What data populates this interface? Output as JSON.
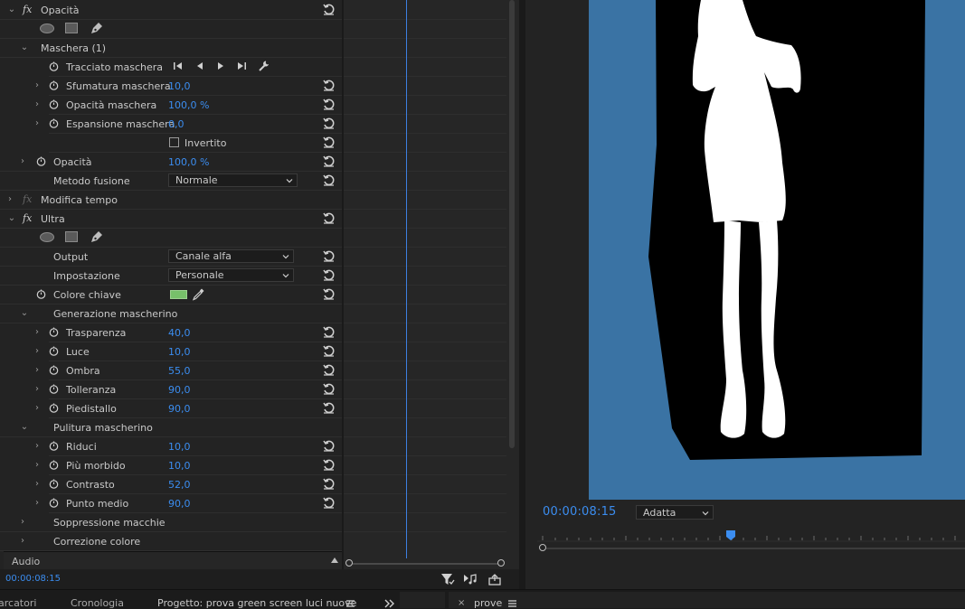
{
  "effect_controls": {
    "rows": {
      "opacity_effect": "Opacità",
      "mask1": "Maschera (1)",
      "mask_path": "Tracciato maschera",
      "mask_feather": {
        "label": "Sfumatura maschera",
        "value": "10,0"
      },
      "mask_opacity": {
        "label": "Opacità maschera",
        "value": "100,0 %"
      },
      "mask_expansion": {
        "label": "Espansione maschera",
        "value": "0,0"
      },
      "inverted": "Invertito",
      "opacity": {
        "label": "Opacità",
        "value": "100,0 %"
      },
      "blend_mode": {
        "label": "Metodo fusione",
        "value": "Normale"
      },
      "time_remap": "Modifica tempo",
      "ultra": "Ultra",
      "output": {
        "label": "Output",
        "value": "Canale alfa"
      },
      "setting": {
        "label": "Impostazione",
        "value": "Personale"
      },
      "key_color": {
        "label": "Colore chiave",
        "color": "#77c06a"
      },
      "matte_generation": "Generazione mascherino",
      "transparency": {
        "label": "Trasparenza",
        "value": "40,0"
      },
      "highlight": {
        "label": "Luce",
        "value": "10,0"
      },
      "shadow": {
        "label": "Ombra",
        "value": "55,0"
      },
      "tolerance": {
        "label": "Tolleranza",
        "value": "90,0"
      },
      "pedestal": {
        "label": "Piedistallo",
        "value": "90,0"
      },
      "matte_cleanup": "Pulitura mascherino",
      "choke": {
        "label": "Riduci",
        "value": "10,0"
      },
      "soften": {
        "label": "Più morbido",
        "value": "10,0"
      },
      "contrast": {
        "label": "Contrasto",
        "value": "52,0"
      },
      "midpoint": {
        "label": "Punto medio",
        "value": "90,0"
      },
      "spill_suppression": "Soppressione macchie",
      "color_correction": "Correzione colore"
    },
    "audio": "Audio",
    "timecode": "00:00:08:15"
  },
  "program_monitor": {
    "timecode": "00:00:08:15",
    "fit": "Adatta"
  },
  "bottom_tabs": {
    "markers": "arcatori",
    "history": "Cronologia",
    "project": "Progetto: prova green screen luci nuove",
    "sequence": "prove"
  },
  "colors": {
    "accent_blue": "#3b8df0",
    "video_bg": "#3a73a4"
  }
}
